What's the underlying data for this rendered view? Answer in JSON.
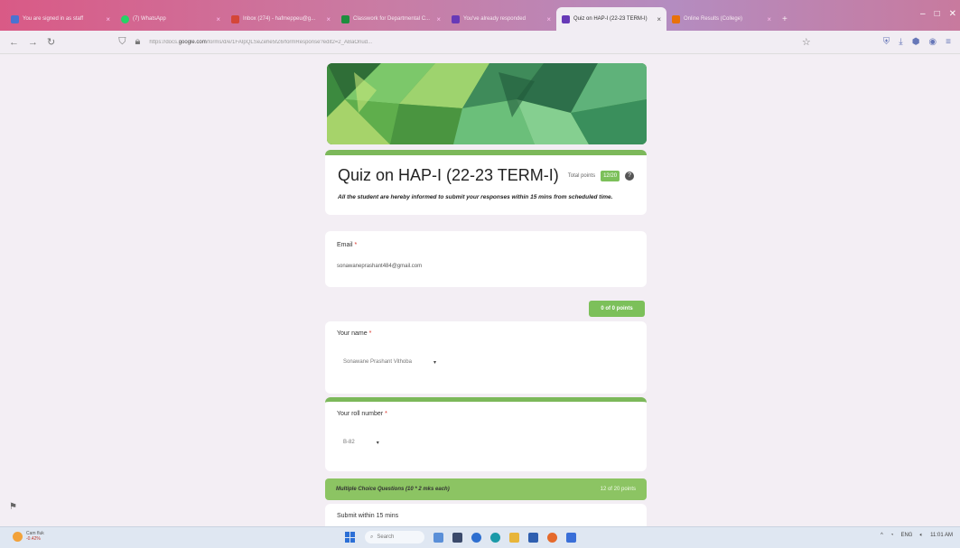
{
  "browser": {
    "tabs": [
      {
        "label": "You are signed in as staff",
        "color": "#4a73d1",
        "active": false
      },
      {
        "label": "(7) WhatsApp",
        "color": "#25d366",
        "active": false
      },
      {
        "label": "Inbox (274) - hafmeppeu@g...",
        "color": "#d44638",
        "active": false
      },
      {
        "label": "Classwork for Departmental C...",
        "color": "#1e8e3e",
        "active": false
      },
      {
        "label": "You've already responded",
        "color": "#673ab7",
        "active": false
      },
      {
        "label": "Quiz on HAP-I (22-23 TERM-I)",
        "color": "#673ab7",
        "active": true
      },
      {
        "label": "Online Results (College)",
        "color": "#e8710a",
        "active": false
      }
    ],
    "new_tab": "+",
    "url_prefix": "https://docs.",
    "url_domain": "google.com",
    "url_rest": "/forms/d/e/1FAIpQLSeZehe5fZ6/formResponse?edit2=2_ABaOnud..."
  },
  "form": {
    "title": "Quiz on HAP-I (22-23 TERM-I)",
    "total_points_label": "Total points",
    "total_points_value": "12/20",
    "description": "All the student are hereby informed to submit your responses within 15 mins from scheduled time.",
    "email_label": "Email",
    "email_value": "sonawaneprashant484@gmail.com",
    "section1_score": "0 of 0 points",
    "name_label": "Your name",
    "name_value": "Sonawane Prashant Vithoba",
    "roll_label": "Your roll number",
    "roll_value": "B-82",
    "section2_title": "Multiple Choice Questions (10 * 2 mks each)",
    "section2_score": "12 of 20 points",
    "mcq_intro": "Submit within 15 mins",
    "required_mark": "*"
  },
  "taskbar": {
    "weather_temp": "Cam fluk",
    "weather_sub": "-0.42%",
    "search_label": "Search",
    "tray_lang": "ENG",
    "tray_time": "11:01 AM"
  },
  "colors": {
    "accent": "#7cc05a",
    "banner": "#5aa548"
  }
}
